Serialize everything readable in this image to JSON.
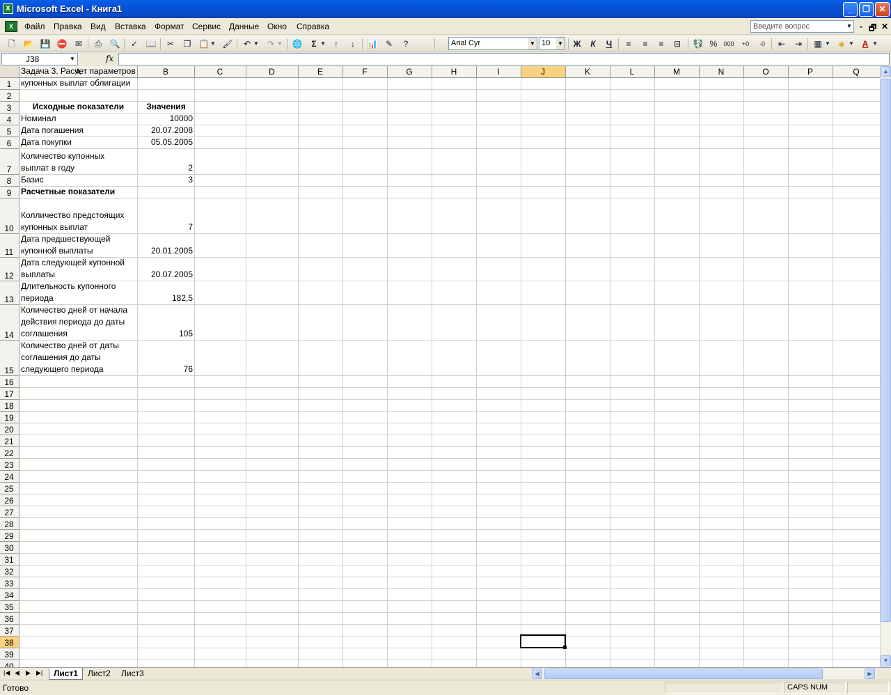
{
  "window": {
    "title": "Microsoft Excel - Книга1"
  },
  "menu": [
    "Файл",
    "Правка",
    "Вид",
    "Вставка",
    "Формат",
    "Сервис",
    "Данные",
    "Окно",
    "Справка"
  ],
  "help_placeholder": "Введите вопрос",
  "font": {
    "name": "Arial Cyr",
    "size": "10"
  },
  "format_buttons": {
    "bold": "Ж",
    "italic": "К",
    "underline": "Ч"
  },
  "name_box": "J38",
  "fx_label": "fx",
  "columns": [
    "A",
    "B",
    "C",
    "D",
    "E",
    "F",
    "G",
    "H",
    "I",
    "J",
    "K",
    "L",
    "M",
    "N",
    "O",
    "P",
    "Q"
  ],
  "active_column": "J",
  "active_row": "38",
  "cells": {
    "A1": "Задача 3. Расчет параметров купонных выплат облигации",
    "A3": "Исходные показатели",
    "B3": "Значения",
    "A4": "Номинал",
    "B4": "10000",
    "A5": "Дата погашения",
    "B5": "20.07.2008",
    "A6": "Дата покупки",
    "B6": "05.05.2005",
    "A7": "Количество купонных\nвыплат в году",
    "B7": "2",
    "A8": "Базис",
    "B8": "3",
    "A9": "Расчетные показатели",
    "A10": "Колличество предстоящих\nкупонных выплат",
    "B10": "7",
    "A11": "Дата предшествующей\nкупонной выплаты",
    "B11": "20.01.2005",
    "A12": "Дата следующей купонной\nвыплаты",
    "B12": "20.07.2005",
    "A13": "Длительность купонного\nпериода",
    "B13": "182,5",
    "A14": "Количество дней от начала\nдействия периода до даты\nсоглашения",
    "B14": "105",
    "A15": "Количество дней от даты\nсоглашения до даты\nследующего периода",
    "B15": "76"
  },
  "sheet_tabs": [
    "Лист1",
    "Лист2",
    "Лист3"
  ],
  "active_sheet": "Лист1",
  "status": {
    "text": "Готово",
    "indicators": "CAPS NUM"
  }
}
